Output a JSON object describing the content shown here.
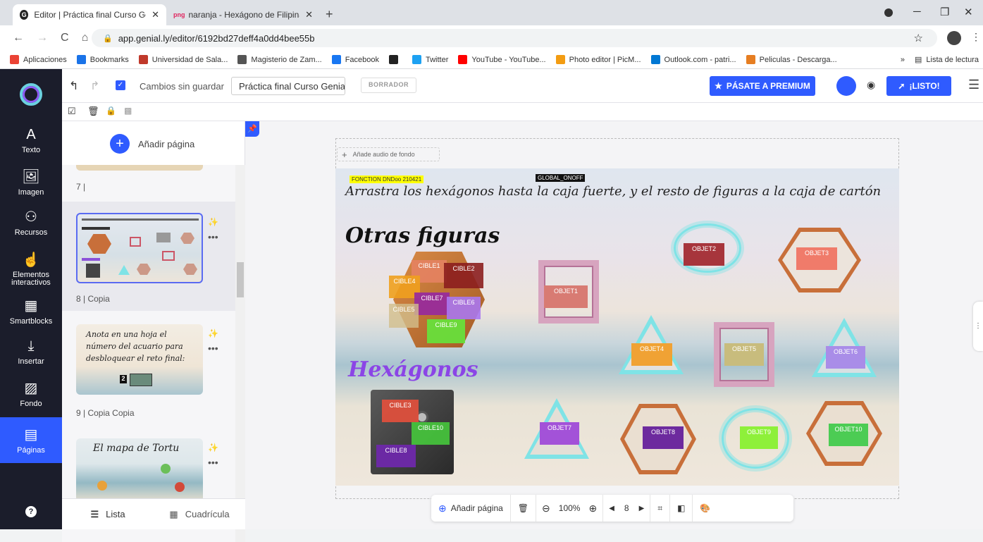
{
  "browser": {
    "tabs": [
      {
        "title": "Editor | Práctica final Curso Genia",
        "close": "✕"
      },
      {
        "title": "naranja - Hexágono de Filipinasc",
        "close": "✕",
        "fav_label": "png"
      }
    ],
    "new_tab": "+",
    "url": "app.genial.ly/editor/6192bd27deff4a0dd4bee55b",
    "bookmarks": [
      {
        "label": "Aplicaciones",
        "color": "#ea4335"
      },
      {
        "label": "Bookmarks",
        "color": "#1a73e8"
      },
      {
        "label": "Universidad de Sala...",
        "color": "#c0392b"
      },
      {
        "label": "Magisterio de Zam...",
        "color": "#555555"
      },
      {
        "label": "Facebook",
        "color": "#1877f2"
      },
      {
        "label": "",
        "color": "#222222"
      },
      {
        "label": "Twitter",
        "color": "#1da1f2"
      },
      {
        "label": "YouTube - YouTube...",
        "color": "#ff0000"
      },
      {
        "label": "Photo editor | PicM...",
        "color": "#f39c12"
      },
      {
        "label": "Outlook.com - patri...",
        "color": "#0078d4"
      },
      {
        "label": "Peliculas - Descarga...",
        "color": "#e67e22"
      }
    ],
    "reading_list": "Lista de lectura",
    "more": "»"
  },
  "toolbar": {
    "status": "Cambios sin guardar",
    "title_input": "Práctica final Curso Genial",
    "draft_badge": "BORRADOR",
    "premium_button": "PÁSATE A PREMIUM",
    "ready_button": "¡LISTO!"
  },
  "sidebar": {
    "items": [
      {
        "label": "Texto",
        "icon": "A"
      },
      {
        "label": "Imagen",
        "icon": "🖼"
      },
      {
        "label": "Recursos",
        "icon": "⚇"
      },
      {
        "label": "Elementos interactivos",
        "icon": "☝"
      },
      {
        "label": "Smartblocks",
        "icon": "▦"
      },
      {
        "label": "Insertar",
        "icon": "⤓"
      },
      {
        "label": "Fondo",
        "icon": "▨"
      },
      {
        "label": "Páginas",
        "icon": "▤"
      }
    ],
    "help": "?"
  },
  "pages_panel": {
    "add_page": "Añadir página",
    "page7": "7 |",
    "page8": "8 |  Copia",
    "page9": "9 |  Copia Copia",
    "page9_text": "Anota en una hoja el número del acuario para desbloquear el reto final:",
    "page9_num": "2",
    "page10_text": "El mapa de Tortu",
    "list_tab": "Lista",
    "grid_tab": "Cuadrícula"
  },
  "canvas": {
    "add_audio": "Añade audio de fondo",
    "fonction_tag": "FONCTION DNDoo 210421",
    "global_tag": "GLOBAL_ONOFF",
    "instruction": "Arrastra los hexágonos hasta la caja fuerte, y el resto de figuras a la caja de cartón",
    "heading1": "Otras figuras",
    "heading2": "Hexágonos",
    "cibles": [
      "CIBLE1",
      "CIBLE2",
      "CIBLE4",
      "CIBLE7",
      "CIBLE6",
      "CIBLE5",
      "CIBLE9",
      "CIBLE3",
      "CIBLE10",
      "CIBLE8"
    ],
    "objets": [
      "OBJET1",
      "OBJET2",
      "OBJET3",
      "OBJET4",
      "OBJET5",
      "OBJET6",
      "OBJET7",
      "OBJET8",
      "OBJET9",
      "OBJET10"
    ]
  },
  "bottom": {
    "add_page": "Añadir página",
    "zoom": "100%",
    "page_number": "8"
  },
  "colors": {
    "accent": "#2f5bff",
    "sidebar_bg": "#1b1d2b"
  }
}
